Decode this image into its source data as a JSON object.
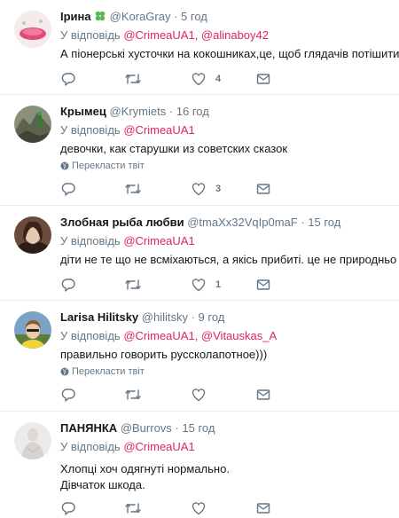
{
  "reply_prefix": "У відповідь",
  "translate_label": "Перекласти твіт",
  "colors": {
    "mention": "#e0245e",
    "muted": "#657786",
    "border": "#e6ecf0"
  },
  "tweets": [
    {
      "name": "Ірина",
      "handle": "@KoraGray",
      "time": "5 год",
      "mentions": "@CrimeaUA1, @alinaboy42",
      "text": "А піонерські хусточки на кокошниках,це, щоб глядачів потішити?",
      "likes": "4"
    },
    {
      "name": "Крымец",
      "handle": "@Krymiets",
      "time": "16 год",
      "mentions": "@CrimeaUA1",
      "text": "девочки, как старушки из советских сказок",
      "likes": "3"
    },
    {
      "name": "Злобная рыба любви",
      "handle": "@tmaXx32VqIp0maF",
      "time": "15 год",
      "mentions": "@CrimeaUA1",
      "text": "діти не те що не всміхаються, а якісь прибиті. це не природньо",
      "likes": "1"
    },
    {
      "name": "Larisa Hilitsky",
      "handle": "@hilitsky",
      "time": "9 год",
      "mentions": "@CrimeaUA1, @Vitauskas_A",
      "text": "правильно говорить руссколапотное)))"
    },
    {
      "name": "ПАНЯНКА",
      "handle": "@Burrovs",
      "time": "15 год",
      "mentions": "@CrimeaUA1",
      "text_lines": [
        "Хлопці хоч одягнуті нормально.",
        "Дівчаток шкода."
      ]
    }
  ]
}
